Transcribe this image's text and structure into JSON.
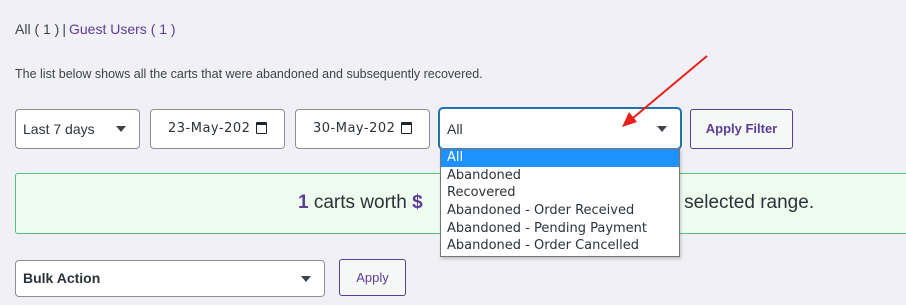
{
  "filters_nav": {
    "all_label": "All",
    "all_count": "( 1 )",
    "separator": "|",
    "guest_label": "Guest Users",
    "guest_count": "( 1 )"
  },
  "description": "The list below shows all the carts that were abandoned and subsequently recovered.",
  "date_range": {
    "selected": "Last 7 days"
  },
  "start_date": {
    "value": "23-May-202"
  },
  "end_date": {
    "value": "30-May-202"
  },
  "status_filter": {
    "selected": "All",
    "options": [
      "All",
      "Abandoned",
      "Recovered",
      "Abandoned - Order Received",
      "Abandoned - Pending Payment",
      "Abandoned - Order Cancelled"
    ]
  },
  "apply_filter_label": "Apply Filter",
  "notice": {
    "count": "1",
    "text_before": " carts worth ",
    "currency": "$",
    "text_after": "g the selected range."
  },
  "bulk_action": {
    "selected": "Bulk Action"
  },
  "apply_label": "Apply",
  "colors": {
    "accent": "#5b3e96",
    "highlight": "#1e90ff",
    "notice_bg": "#eefbef",
    "notice_border": "#58c07a",
    "annotation_arrow": "#e8201c"
  },
  "icons": [
    "calendar-icon",
    "chevron-down-icon",
    "annotation-arrow"
  ]
}
